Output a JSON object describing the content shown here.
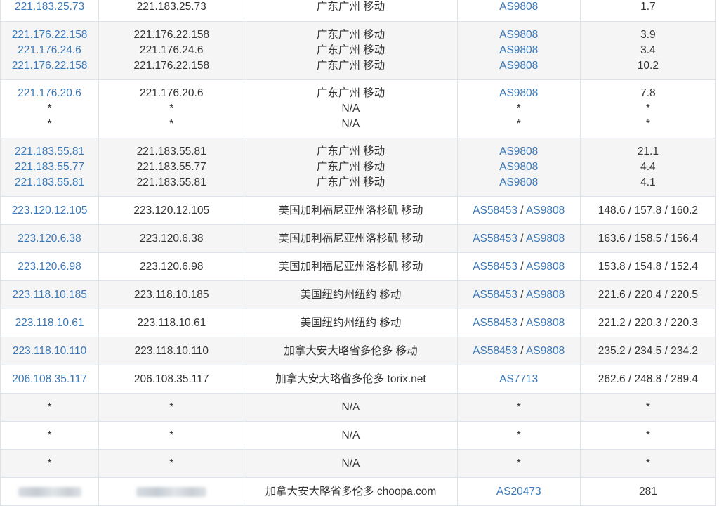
{
  "rows": [
    {
      "h": 42,
      "alt": false,
      "hops": [
        {
          "ip": "221.183.25.73",
          "host": "221.183.25.73",
          "loc": "广东广州 移动",
          "as": [
            "AS9808"
          ],
          "time": "1.7"
        }
      ]
    },
    {
      "h": 83,
      "alt": true,
      "hops": [
        {
          "ip": "221.176.22.158",
          "host": "221.176.22.158",
          "loc": "广东广州 移动",
          "as": [
            "AS9808"
          ],
          "time": "3.9"
        },
        {
          "ip": "221.176.24.6",
          "host": "221.176.24.6",
          "loc": "广东广州 移动",
          "as": [
            "AS9808"
          ],
          "time": "3.4"
        },
        {
          "ip": "221.176.22.158",
          "host": "221.176.22.158",
          "loc": "广东广州 移动",
          "as": [
            "AS9808"
          ],
          "time": "10.2"
        }
      ]
    },
    {
      "h": 83,
      "alt": false,
      "hops": [
        {
          "ip": "221.176.20.6",
          "host": "221.176.20.6",
          "loc": "广东广州 移动",
          "as": [
            "AS9808"
          ],
          "time": "7.8"
        },
        {
          "ip": "*",
          "host": "*",
          "loc": "N/A",
          "as": [
            "*"
          ],
          "time": "*"
        },
        {
          "ip": "*",
          "host": "*",
          "loc": "N/A",
          "as": [
            "*"
          ],
          "time": "*"
        }
      ]
    },
    {
      "h": 83,
      "alt": true,
      "hops": [
        {
          "ip": "221.183.55.81",
          "host": "221.183.55.81",
          "loc": "广东广州 移动",
          "as": [
            "AS9808"
          ],
          "time": "21.1"
        },
        {
          "ip": "221.183.55.77",
          "host": "221.183.55.77",
          "loc": "广东广州 移动",
          "as": [
            "AS9808"
          ],
          "time": "4.4"
        },
        {
          "ip": "221.183.55.81",
          "host": "221.183.55.81",
          "loc": "广东广州 移动",
          "as": [
            "AS9808"
          ],
          "time": "4.1"
        }
      ]
    },
    {
      "h": 40,
      "alt": false,
      "hops": [
        {
          "ip": "223.120.12.105",
          "host": "223.120.12.105",
          "loc": "美国加利福尼亚州洛杉矶 移动",
          "as": [
            "AS58453",
            "AS9808"
          ],
          "time": "148.6 / 157.8 / 160.2"
        }
      ]
    },
    {
      "h": 40,
      "alt": true,
      "hops": [
        {
          "ip": "223.120.6.38",
          "host": "223.120.6.38",
          "loc": "美国加利福尼亚州洛杉矶 移动",
          "as": [
            "AS58453",
            "AS9808"
          ],
          "time": "163.6 / 158.5 / 156.4"
        }
      ]
    },
    {
      "h": 40,
      "alt": false,
      "hops": [
        {
          "ip": "223.120.6.98",
          "host": "223.120.6.98",
          "loc": "美国加利福尼亚州洛杉矶 移动",
          "as": [
            "AS58453",
            "AS9808"
          ],
          "time": "153.8 / 154.8 / 152.4"
        }
      ]
    },
    {
      "h": 40,
      "alt": true,
      "hops": [
        {
          "ip": "223.118.10.185",
          "host": "223.118.10.185",
          "loc": "美国纽约州纽约 移动",
          "as": [
            "AS58453",
            "AS9808"
          ],
          "time": "221.6 / 220.4 / 220.5"
        }
      ]
    },
    {
      "h": 40,
      "alt": false,
      "hops": [
        {
          "ip": "223.118.10.61",
          "host": "223.118.10.61",
          "loc": "美国纽约州纽约 移动",
          "as": [
            "AS58453",
            "AS9808"
          ],
          "time": "221.2 / 220.3 / 220.3"
        }
      ]
    },
    {
      "h": 40,
      "alt": true,
      "hops": [
        {
          "ip": "223.118.10.110",
          "host": "223.118.10.110",
          "loc": "加拿大安大略省多伦多 移动",
          "as": [
            "AS58453",
            "AS9808"
          ],
          "time": "235.2 / 234.5 / 234.2"
        }
      ]
    },
    {
      "h": 40,
      "alt": false,
      "hops": [
        {
          "ip": "206.108.35.117",
          "host": "206.108.35.117",
          "loc": "加拿大安大略省多伦多 torix.net",
          "as": [
            "AS7713"
          ],
          "time": "262.6 / 248.8 / 289.4"
        }
      ]
    },
    {
      "h": 40,
      "alt": true,
      "hops": [
        {
          "ip": "*",
          "host": "*",
          "loc": "N/A",
          "as": [
            "*"
          ],
          "time": "*"
        }
      ]
    },
    {
      "h": 40,
      "alt": false,
      "hops": [
        {
          "ip": "*",
          "host": "*",
          "loc": "N/A",
          "as": [
            "*"
          ],
          "time": "*"
        }
      ]
    },
    {
      "h": 40,
      "alt": true,
      "hops": [
        {
          "ip": "*",
          "host": "*",
          "loc": "N/A",
          "as": [
            "*"
          ],
          "time": "*"
        }
      ]
    },
    {
      "h": 40,
      "alt": false,
      "hops": [
        {
          "ip": "",
          "host": "",
          "loc": "加拿大安大略省多伦多 choopa.com",
          "as": [
            "AS20473"
          ],
          "time": "281",
          "redacted": true
        }
      ]
    }
  ],
  "separator": " / ",
  "colors": {
    "link": "#3a78b8",
    "text": "#333333",
    "border": "#dde3e8",
    "alt_row": "#f5f5f5"
  }
}
